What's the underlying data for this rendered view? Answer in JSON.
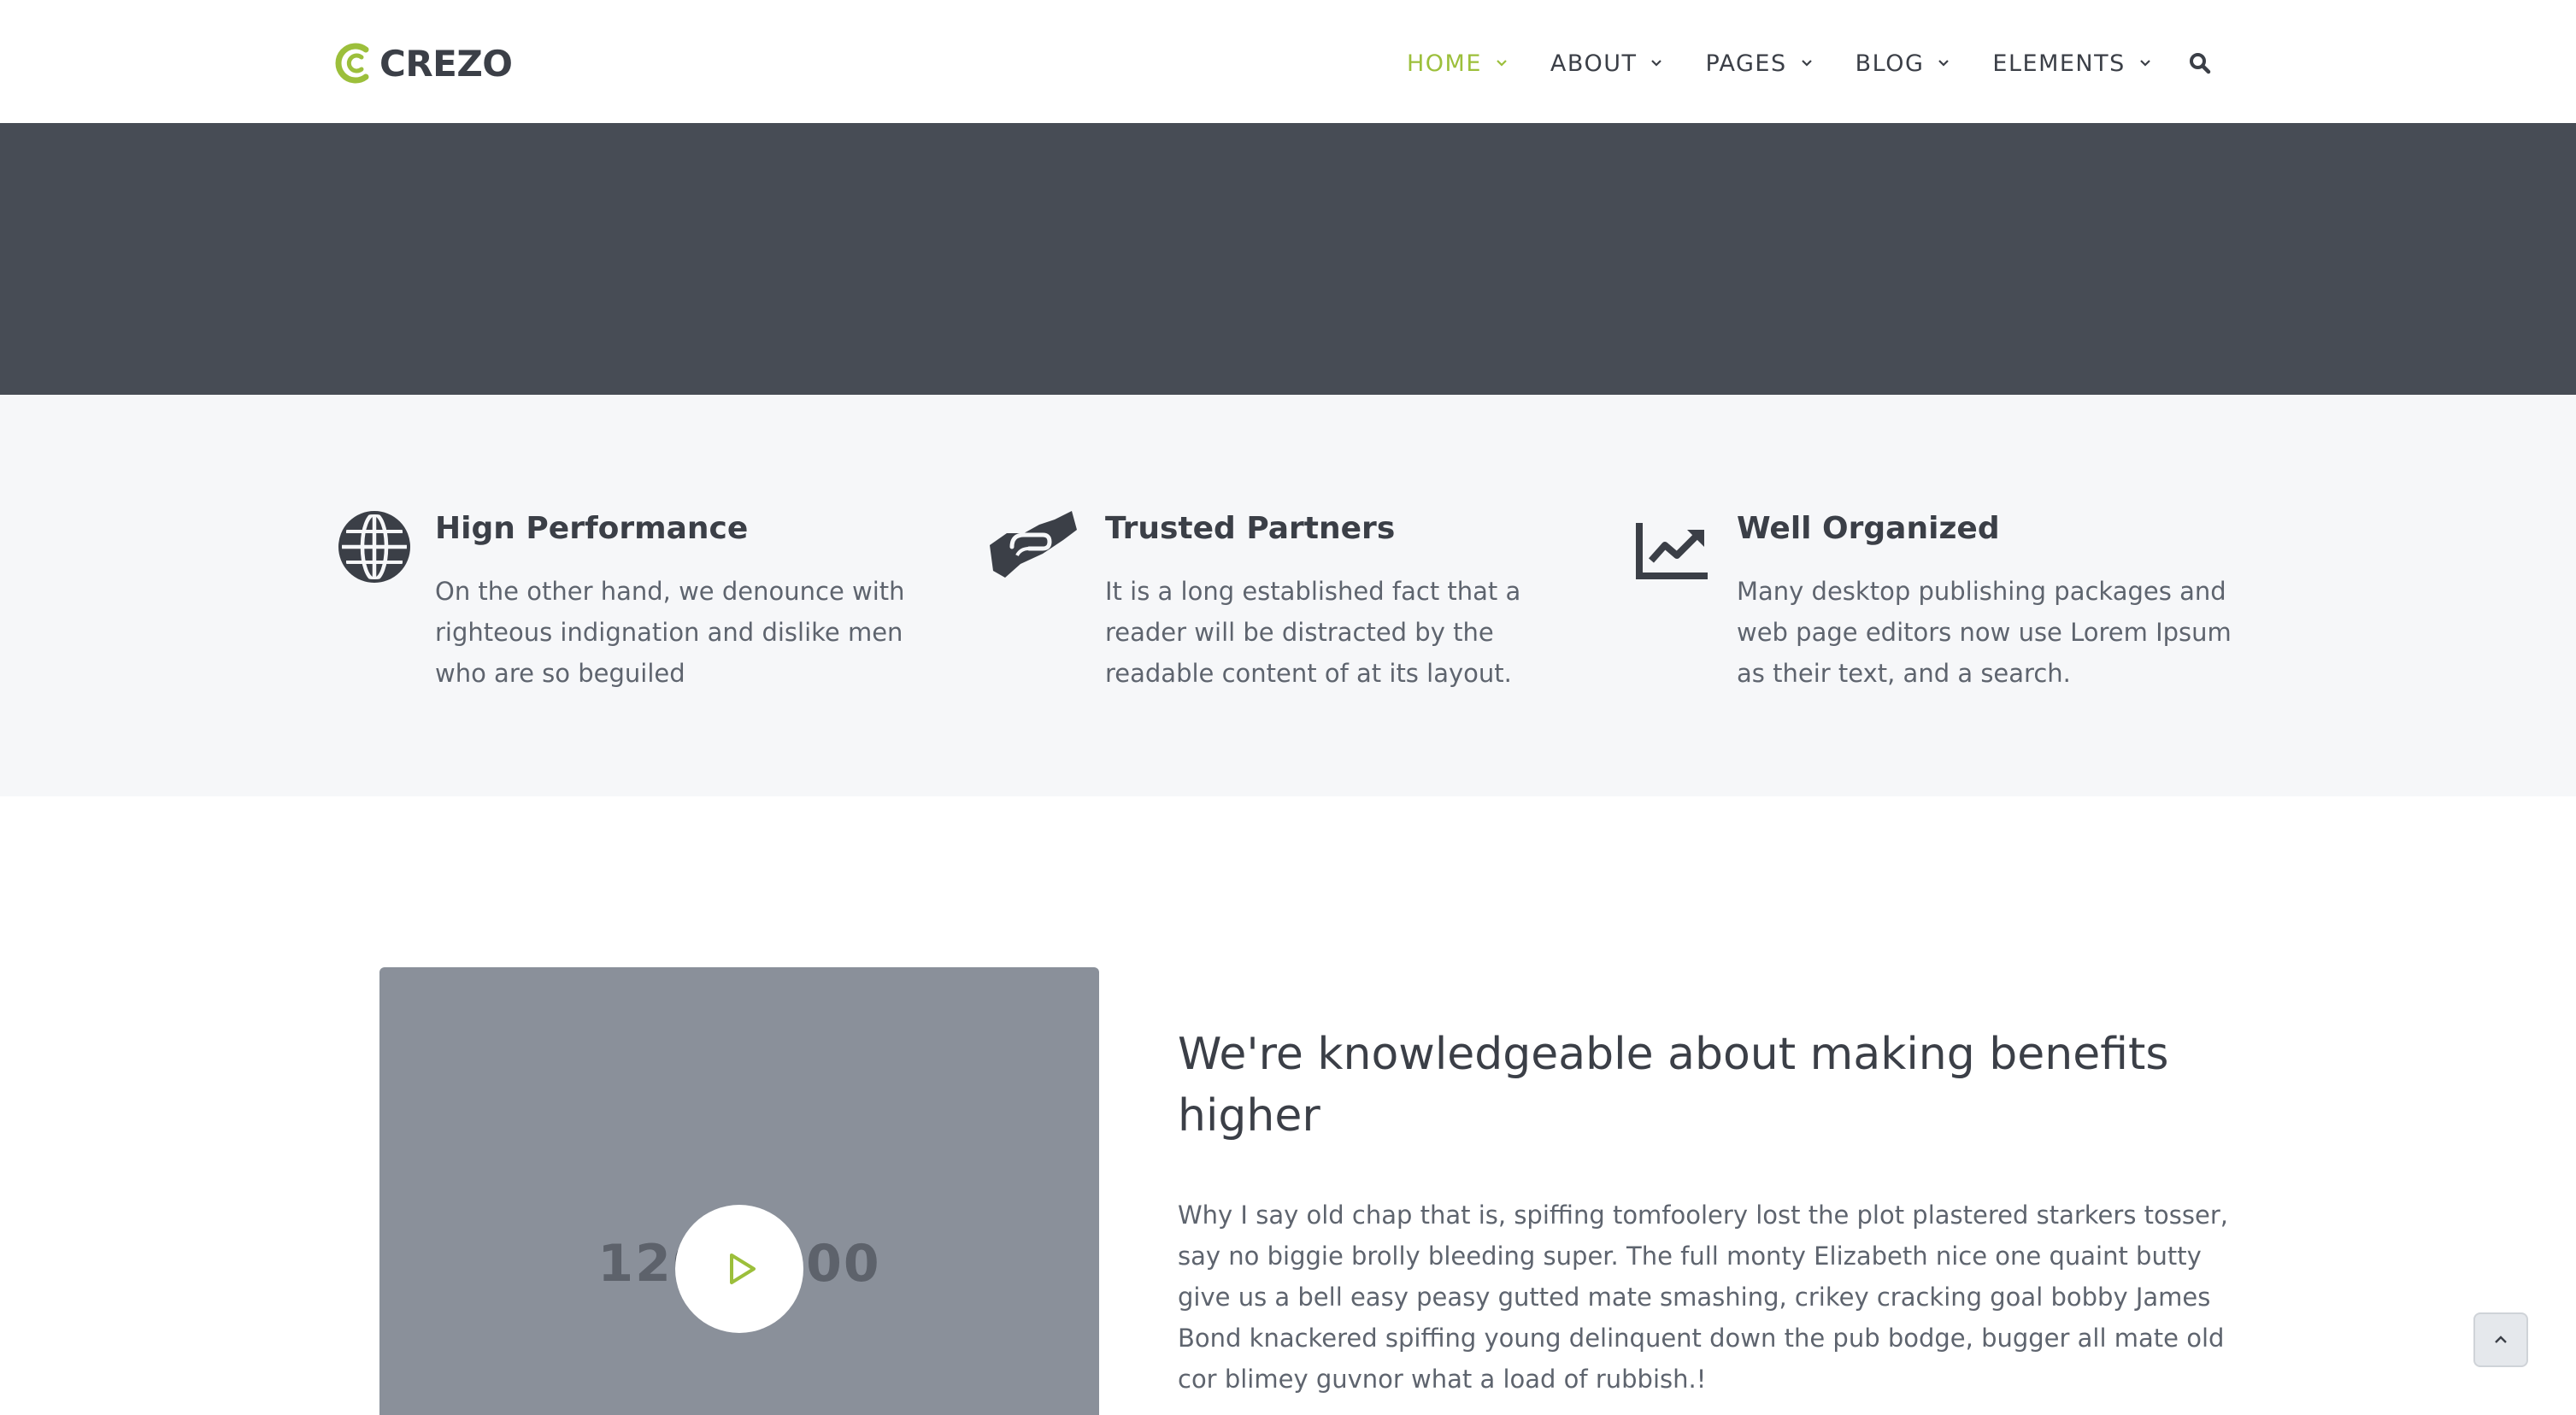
{
  "header": {
    "logo_text": "CREZO",
    "nav": [
      {
        "label": "HOME",
        "active": true
      },
      {
        "label": "ABOUT",
        "active": false
      },
      {
        "label": "PAGES",
        "active": false
      },
      {
        "label": "BLOG",
        "active": false
      },
      {
        "label": "ELEMENTS",
        "active": false
      }
    ],
    "search_icon": "search-icon"
  },
  "features": [
    {
      "icon": "globe-icon",
      "title": "Hign Performance",
      "description": "On the other hand, we denounce with righteous indignation and dislike men who are so beguiled"
    },
    {
      "icon": "handshake-icon",
      "title": "Trusted Partners",
      "description": "It is a long established fact that a reader will be distracted by the readable content of at its layout."
    },
    {
      "icon": "chart-line-icon",
      "title": "Well Organized",
      "description": "Many desktop publishing packages and web page editors now use Lorem Ipsum as their text, and a search."
    }
  ],
  "about": {
    "video_placeholder": "120   000",
    "play_icon": "play-icon",
    "heading": "We're knowledgeable about making benefits higher",
    "text": "Why I say old chap that is, spiffing tomfoolery lost the plot plastered starkers tosser, say no biggie brolly bleeding super. The full monty Elizabeth nice one quaint butty give us a bell easy peasy gutted mate smashing, crikey cracking goal bobby James Bond knackered spiffing young delinquent down the pub bodge, bugger all mate old cor blimey guvnor what a load of rubbish.!"
  },
  "scroll_top_icon": "chevron-up-icon",
  "colors": {
    "accent": "#9cbf3b",
    "dark": "#3b3f47",
    "banner": "#474c55",
    "features_bg": "#f6f7f9",
    "video_bg": "#8a909a"
  }
}
